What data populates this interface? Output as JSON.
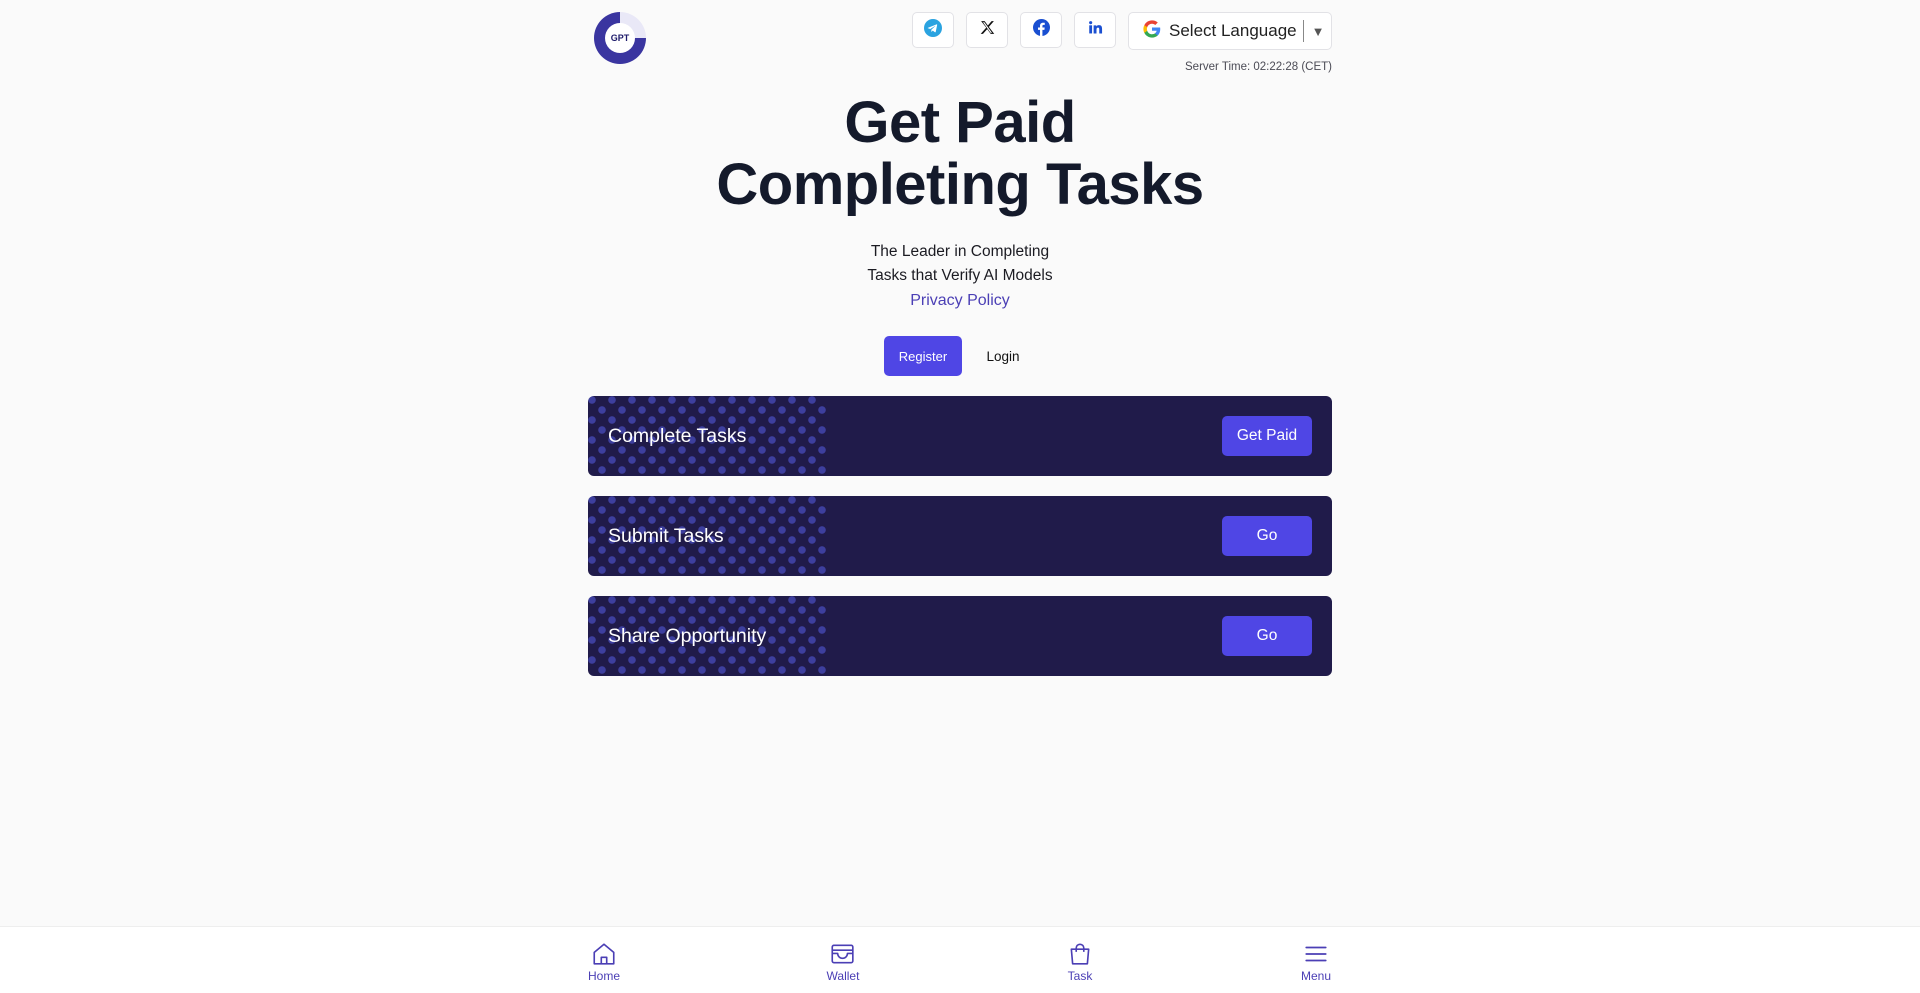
{
  "header": {
    "logo_text": "GPT",
    "socials": [
      {
        "name": "telegram",
        "icon": "telegram-icon",
        "color": "#2aa3e0"
      },
      {
        "name": "x",
        "icon": "x-icon",
        "color": "#111111"
      },
      {
        "name": "facebook",
        "icon": "facebook-icon",
        "color": "#1a4fd1"
      },
      {
        "name": "linkedin",
        "icon": "linkedin-icon",
        "color": "#1a4fd1"
      }
    ],
    "language_select": {
      "label": "Select Language",
      "icon": "google-icon",
      "arrow": "▼"
    },
    "server_time": "Server Time: 02:22:28 (CET)"
  },
  "hero": {
    "title_line1": "Get Paid",
    "title_line2": "Completing Tasks",
    "subtitle_line1": "The Leader in Completing",
    "subtitle_line2": "Tasks that Verify AI Models",
    "privacy_link": "Privacy Policy"
  },
  "auth": {
    "register_label": "Register",
    "login_label": "Login"
  },
  "cards": [
    {
      "title": "Complete Tasks",
      "button": "Get Paid"
    },
    {
      "title": "Submit Tasks",
      "button": "Go"
    },
    {
      "title": "Share Opportunity",
      "button": "Go"
    }
  ],
  "bottom_nav": [
    {
      "label": "Home",
      "icon": "home-icon"
    },
    {
      "label": "Wallet",
      "icon": "wallet-icon"
    },
    {
      "label": "Task",
      "icon": "shopping-bag-icon"
    },
    {
      "label": "Menu",
      "icon": "menu-icon"
    }
  ],
  "colors": {
    "accent": "#4f46e5",
    "card_bg": "#201b4a",
    "link": "#4b3fb5",
    "page_bg": "#fafafa"
  }
}
